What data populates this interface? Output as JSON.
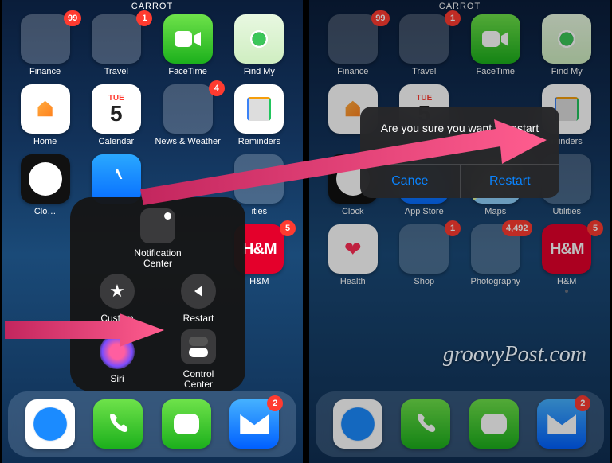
{
  "header": "CARROT",
  "left": {
    "apps": {
      "finance": {
        "label": "Finance",
        "badge": "99"
      },
      "travel": {
        "label": "Travel",
        "badge": "1"
      },
      "facetime": {
        "label": "FaceTime"
      },
      "findmy": {
        "label": "Find My"
      },
      "home": {
        "label": "Home"
      },
      "calendar": {
        "label": "Calendar",
        "dow": "TUE",
        "day": "5"
      },
      "news": {
        "label": "News & Weather",
        "badge": "4"
      },
      "reminders": {
        "label": "Reminders"
      },
      "clock": {
        "label": "Clo…"
      },
      "appstore": {
        "label": ""
      },
      "utilities": {
        "label": "ities"
      },
      "hm": {
        "label": "H&M",
        "text": "H&M",
        "badge": "5"
      }
    },
    "at_menu": {
      "notification": {
        "label": "Notification\nCenter"
      },
      "custom": {
        "label": "Custom"
      },
      "restart": {
        "label": "Restart"
      },
      "siri": {
        "label": "Siri"
      },
      "control_center": {
        "label": "Control\nCenter"
      }
    },
    "dock": {
      "mail_badge": "2"
    }
  },
  "right": {
    "apps": {
      "finance": {
        "label": "Finance",
        "badge": "99"
      },
      "travel": {
        "label": "Travel",
        "badge": "1"
      },
      "facetime": {
        "label": "FaceTime"
      },
      "findmy": {
        "label": "Find My"
      },
      "home": {
        "label": ""
      },
      "calendar": {
        "label": "",
        "dow": "TUE",
        "day": "5"
      },
      "reminders": {
        "label": "minders"
      },
      "clock": {
        "label": "Clock"
      },
      "appstore": {
        "label": "App Store"
      },
      "maps": {
        "label": "Maps"
      },
      "utilities": {
        "label": "Utilities"
      },
      "health": {
        "label": "Health"
      },
      "shop": {
        "label": "Shop",
        "badge": "1"
      },
      "photo": {
        "label": "Photography",
        "badge": "4,492"
      },
      "hm": {
        "label": "H&M",
        "text": "H&M",
        "badge": "5"
      }
    },
    "dialog": {
      "message": "Are you sure you want to restart your iPhone?",
      "cancel": "Cance",
      "restart": "Restart"
    },
    "dock": {
      "mail_badge": "2"
    },
    "dot_label": "•"
  },
  "watermark": "groovyPost.com"
}
